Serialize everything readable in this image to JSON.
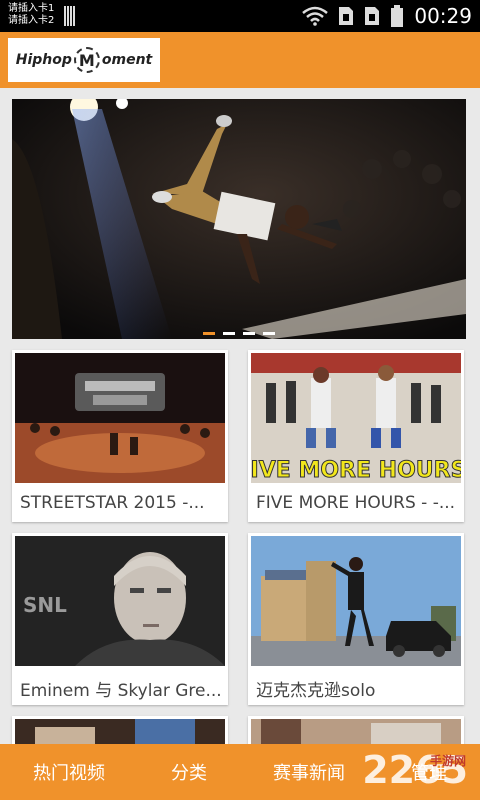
{
  "statusbar": {
    "sim1": "请插入卡1",
    "sim2": "请插入卡2",
    "time": "00:29"
  },
  "app": {
    "logo_part1": "Hiphop",
    "logo_m": "M",
    "logo_part2": "oment"
  },
  "banner": {
    "dots_total": 4,
    "active_dot": 0
  },
  "videos": [
    {
      "title": "STREETSTAR 2015 -..."
    },
    {
      "title": "FIVE MORE HOURS - -...",
      "overlay": "FIVE MORE HOURS!"
    },
    {
      "title": "Eminem 与 Skylar Gre...",
      "overlay": "SNL"
    },
    {
      "title": "迈克杰克逊solo"
    },
    {
      "title": ""
    },
    {
      "title": ""
    }
  ],
  "bottom_nav": {
    "hot_videos": "热门视频",
    "categories": "分类",
    "event_news": "赛事新闻",
    "manage": "管理"
  },
  "watermark": {
    "text": "2265",
    "sub": "手游网"
  },
  "colors": {
    "accent": "#f0922b",
    "statusbar": "#000000",
    "background": "#e9e9e9"
  }
}
